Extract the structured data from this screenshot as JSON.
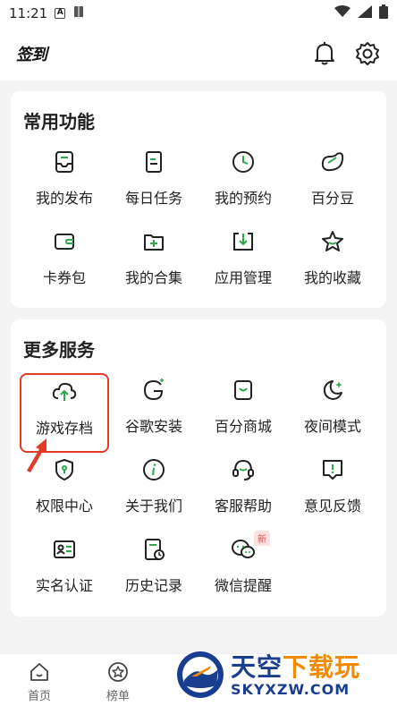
{
  "status_bar": {
    "time": "11:21",
    "icon_a": "A"
  },
  "header": {
    "brand": "签到",
    "icons": [
      "bell-icon",
      "gear-icon"
    ]
  },
  "common": {
    "title": "常用功能",
    "items": [
      {
        "label": "我的发布",
        "icon": "inbox-icon"
      },
      {
        "label": "每日任务",
        "icon": "document-icon"
      },
      {
        "label": "我的预约",
        "icon": "clock-icon"
      },
      {
        "label": "百分豆",
        "icon": "bean-icon"
      },
      {
        "label": "卡券包",
        "icon": "wallet-icon"
      },
      {
        "label": "我的合集",
        "icon": "folder-plus-icon"
      },
      {
        "label": "应用管理",
        "icon": "download-box-icon"
      },
      {
        "label": "我的收藏",
        "icon": "star-icon"
      }
    ]
  },
  "more": {
    "title": "更多服务",
    "items": [
      {
        "label": "游戏存档",
        "icon": "cloud-upload-icon"
      },
      {
        "label": "谷歌安装",
        "icon": "google-icon"
      },
      {
        "label": "百分商城",
        "icon": "shopping-bag-icon"
      },
      {
        "label": "夜间模式",
        "icon": "moon-icon"
      },
      {
        "label": "权限中心",
        "icon": "shield-icon"
      },
      {
        "label": "关于我们",
        "icon": "info-icon"
      },
      {
        "label": "客服帮助",
        "icon": "headset-icon"
      },
      {
        "label": "意见反馈",
        "icon": "feedback-icon"
      },
      {
        "label": "实名认证",
        "icon": "id-card-icon"
      },
      {
        "label": "历史记录",
        "icon": "history-icon"
      },
      {
        "label": "微信提醒",
        "icon": "wechat-icon",
        "badge": "新"
      }
    ]
  },
  "bottom_nav": [
    {
      "label": "首页",
      "icon": "home-icon"
    },
    {
      "label": "榜单",
      "icon": "rank-icon"
    }
  ],
  "watermark": {
    "title_main": "天空",
    "title_accent": "下载玩",
    "url": "SKYXZW.COM"
  },
  "colors": {
    "accent_green": "#2aa84a",
    "highlight_red": "#e23b2a",
    "watermark_blue": "#1a3e8f",
    "watermark_orange": "#f08a00"
  }
}
